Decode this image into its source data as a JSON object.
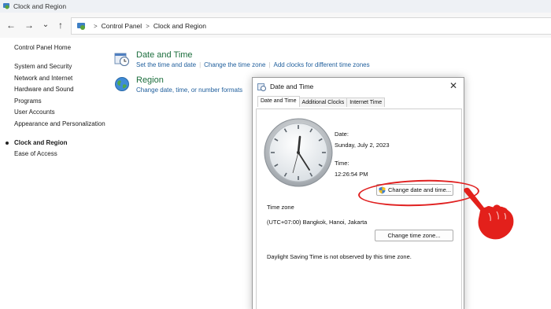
{
  "window": {
    "title": "Clock and Region"
  },
  "nav": {
    "back_icon": "←",
    "forward_icon": "→",
    "dropdown_icon": "⌄",
    "up_icon": "↑"
  },
  "address": {
    "crumbs": [
      "Control Panel",
      "Clock and Region"
    ],
    "separator": ">"
  },
  "sidebar": {
    "home": "Control Panel Home",
    "items": [
      {
        "label": "System and Security"
      },
      {
        "label": "Network and Internet"
      },
      {
        "label": "Hardware and Sound"
      },
      {
        "label": "Programs"
      },
      {
        "label": "User Accounts"
      },
      {
        "label": "Appearance and Personalization"
      },
      {
        "label": "Clock and Region",
        "active": true
      },
      {
        "label": "Ease of Access"
      }
    ]
  },
  "categories": {
    "date_time": {
      "title": "Date and Time",
      "links": [
        "Set the time and date",
        "Change the time zone",
        "Add clocks for different time zones"
      ]
    },
    "region": {
      "title": "Region",
      "links": [
        "Change date, time, or number formats"
      ]
    }
  },
  "dialog": {
    "title": "Date and Time",
    "close_icon": "✕",
    "tabs": [
      "Date and Time",
      "Additional Clocks",
      "Internet Time"
    ],
    "date_label": "Date:",
    "date_value": "Sunday, July 2, 2023",
    "time_label": "Time:",
    "time_value": "12:26:54 PM",
    "change_datetime_button": "Change date and time...",
    "timezone_heading": "Time zone",
    "timezone_value": "(UTC+07:00) Bangkok, Hanoi, Jakarta",
    "change_timezone_button": "Change time zone...",
    "dst_note": "Daylight Saving Time is not observed by this time zone."
  },
  "colors": {
    "highlight": "#e02020",
    "link": "#1f5e9c",
    "category_title": "#1c6e3d"
  }
}
